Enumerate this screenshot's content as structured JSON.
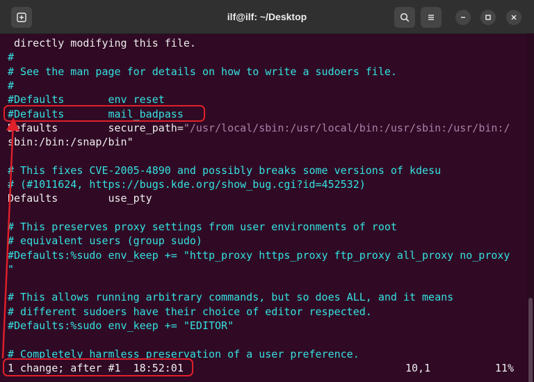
{
  "window": {
    "title": "ilf@ilf: ~/Desktop"
  },
  "icons": {
    "new_tab": "new-tab-icon",
    "search": "search-icon",
    "menu": "hamburger-menu-icon",
    "minimize": "minimize-icon",
    "maximize": "maximize-icon",
    "close": "close-icon"
  },
  "colors": {
    "terminal_bg": "#300a24",
    "comment": "#34e2e2",
    "string": "#ad7fa8",
    "highlight": "#e0202a"
  },
  "lines": [
    {
      "t": " directly modifying this file.",
      "k": "plain"
    },
    {
      "t": "#",
      "k": "comment"
    },
    {
      "t": "# See the man page for details on how to write a sudoers file.",
      "k": "comment"
    },
    {
      "t": "#",
      "k": "comment"
    },
    {
      "t": "#Defaults       env_reset",
      "k": "comment"
    },
    {
      "t": "#Defaults       mail_badpass",
      "k": "comment"
    },
    {
      "t": "Defaults        secure_path=",
      "k": "plain",
      "s": "\"/usr/local/sbin:/usr/local/bin:/usr/sbin:/usr/bin:/"
    },
    {
      "t": "sbin:/bin:/snap/bin\"",
      "k": "string"
    },
    {
      "t": "",
      "k": "plain"
    },
    {
      "t": "# This fixes CVE-2005-4890 and possibly breaks some versions of kdesu",
      "k": "comment"
    },
    {
      "t": "# (#1011624, https://bugs.kde.org/show_bug.cgi?id=452532)",
      "k": "comment"
    },
    {
      "t": "Defaults        use_pty",
      "k": "plain"
    },
    {
      "t": "",
      "k": "plain"
    },
    {
      "t": "# This preserves proxy settings from user environments of root",
      "k": "comment"
    },
    {
      "t": "# equivalent users (group sudo)",
      "k": "comment"
    },
    {
      "t": "#Defaults:%sudo env_keep += \"http_proxy https_proxy ftp_proxy all_proxy no_proxy",
      "k": "comment"
    },
    {
      "t": "\"",
      "k": "comment"
    },
    {
      "t": "",
      "k": "plain"
    },
    {
      "t": "# This allows running arbitrary commands, but so does ALL, and it means",
      "k": "comment"
    },
    {
      "t": "# different sudoers have their choice of editor respected.",
      "k": "comment"
    },
    {
      "t": "#Defaults:%sudo env_keep += \"EDITOR\"",
      "k": "comment"
    },
    {
      "t": "",
      "k": "plain"
    },
    {
      "t": "# Completely harmless preservation of a user preference.",
      "k": "comment"
    }
  ],
  "status": {
    "message": "1 change; after #1  18:52:01",
    "position": "10,1",
    "percent": "11%"
  }
}
